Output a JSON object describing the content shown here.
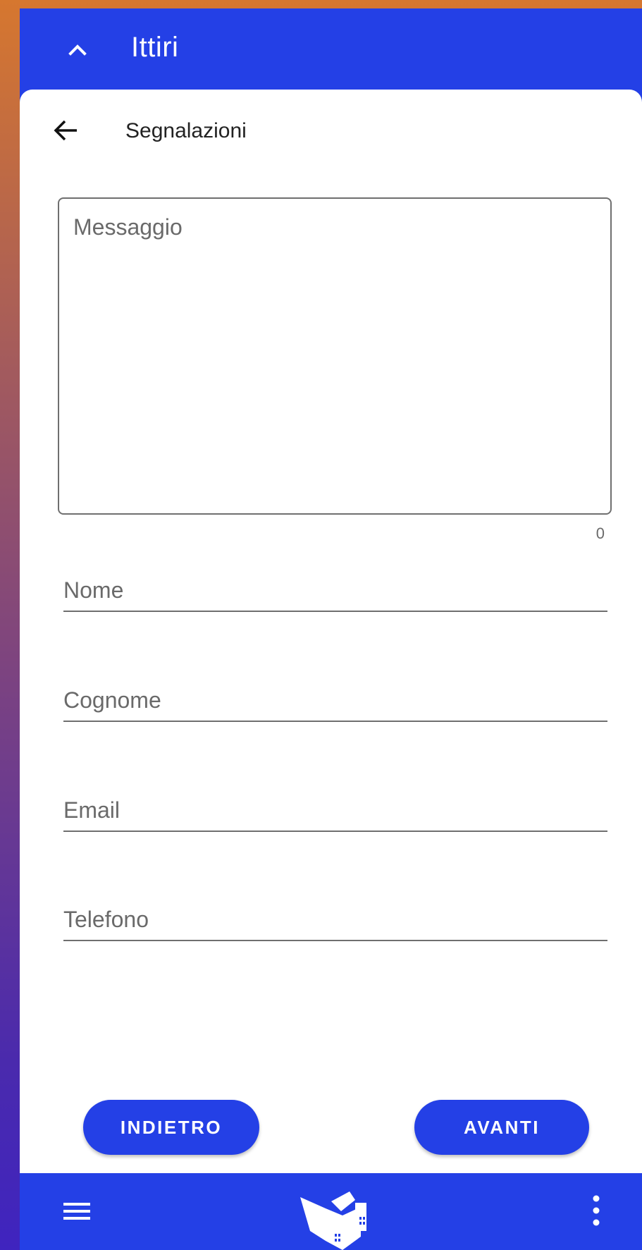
{
  "topbar": {
    "title": "Ittiri"
  },
  "subheader": {
    "title": "Segnalazioni"
  },
  "form": {
    "message_placeholder": "Messaggio",
    "char_count": "0",
    "nome_placeholder": "Nome",
    "cognome_placeholder": "Cognome",
    "email_placeholder": "Email",
    "telefono_placeholder": "Telefono"
  },
  "buttons": {
    "back_label": "INDIETRO",
    "next_label": "AVANTI"
  },
  "bottombar": {
    "menu_icon": "hamburger-menu-icon",
    "logo_icon": "city-logo-icon",
    "more_icon": "more-vertical-icon"
  },
  "colors": {
    "primary": "#2440e6",
    "surface": "#ffffff",
    "text_secondary": "#6a6a6a"
  }
}
